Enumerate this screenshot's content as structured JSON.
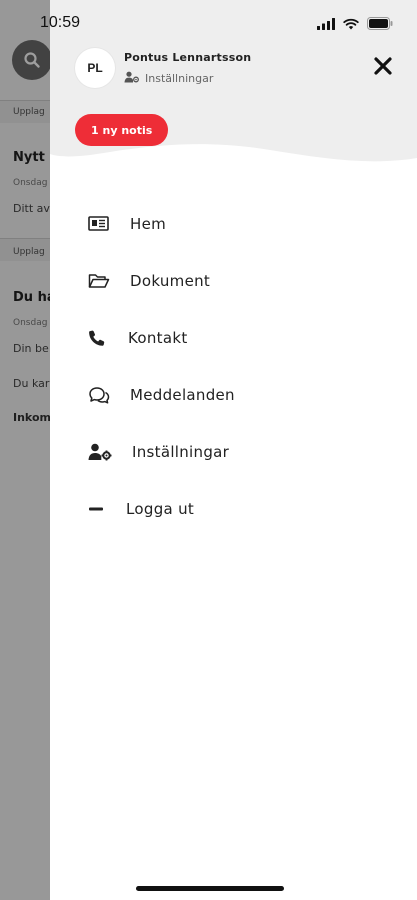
{
  "status_bar": {
    "time": "10:59"
  },
  "background": {
    "rows": [
      {
        "section": "Upplag",
        "title": "Nytt",
        "date": "Onsdag",
        "text": "Ditt av"
      },
      {
        "section": "Upplag",
        "title": "Du ha",
        "date": "Onsdag",
        "text": "Din be",
        "text2": "Du kar",
        "strong": "Inkom"
      }
    ]
  },
  "drawer": {
    "avatar_initials": "PL",
    "user_name": "Pontus Lennartsson",
    "settings_label": "Inställningar",
    "notice_label": "1 ny notis",
    "menu": [
      {
        "label": "Hem",
        "icon": "news-icon"
      },
      {
        "label": "Dokument",
        "icon": "folder-open-icon"
      },
      {
        "label": "Kontakt",
        "icon": "phone-icon"
      },
      {
        "label": "Meddelanden",
        "icon": "chat-bubbles-icon"
      },
      {
        "label": "Inställningar",
        "icon": "user-cog-icon"
      },
      {
        "label": "Logga ut",
        "icon": "minus-icon"
      }
    ]
  },
  "colors": {
    "accent": "#ee2d37",
    "header_bg": "#eeeeee",
    "overlay": "#000000"
  }
}
